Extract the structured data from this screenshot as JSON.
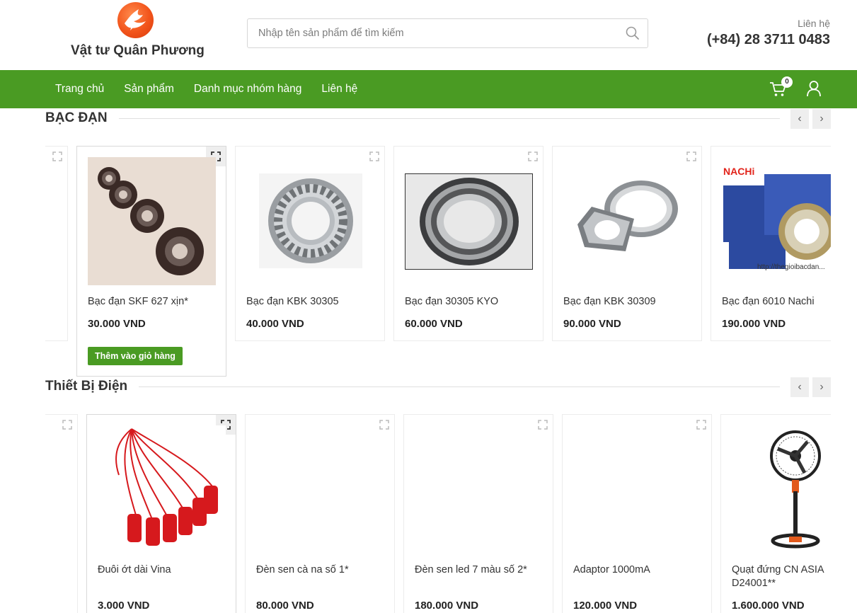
{
  "header": {
    "site_name": "Vật tư Quân Phương",
    "search_placeholder": "Nhập tên sản phẩm để tìm kiếm",
    "contact_label": "Liên hệ",
    "contact_phone": "(+84) 28 3711 0483"
  },
  "nav": {
    "items": [
      {
        "label": "Trang chủ"
      },
      {
        "label": "Sản phẩm"
      },
      {
        "label": "Danh mục nhóm hàng"
      },
      {
        "label": "Liên hệ"
      }
    ],
    "cart_count": "0",
    "accent_color": "#4a9b23"
  },
  "sections": [
    {
      "title": "BẠC ĐẠN",
      "prev_icon": "chevron-left-icon",
      "next_icon": "chevron-right-icon",
      "products": [
        {
          "name": "Bạc đạn SKF 627 xịn*",
          "price": "30.000 VND",
          "add_to_cart": "Thêm vào giỏ hàng"
        },
        {
          "name": "Bạc đạn KBK 30305",
          "price": "40.000 VND"
        },
        {
          "name": "Bạc đạn 30305 KYO",
          "price": "60.000 VND"
        },
        {
          "name": "Bạc đạn KBK 30309",
          "price": "90.000 VND"
        },
        {
          "name": "Bạc đạn 6010 Nachi",
          "price": "190.000 VND",
          "image_text_brand": "NACHi",
          "image_text_url": "http://thegioibacdan..."
        }
      ]
    },
    {
      "title": "Thiết Bị Điện",
      "prev_icon": "chevron-left-icon",
      "next_icon": "chevron-right-icon",
      "products": [
        {
          "name": "Đuôi ớt dài Vina",
          "price": "3.000 VND"
        },
        {
          "name": "Đèn sen cà na số 1*",
          "price": "80.000 VND"
        },
        {
          "name": "Đèn sen led 7 màu số 2*",
          "price": "180.000 VND"
        },
        {
          "name": "Adaptor 1000mA",
          "price": "120.000 VND"
        },
        {
          "name": "Quạt đứng CN ASIA D24001**",
          "price": "1.600.000 VND"
        }
      ]
    }
  ]
}
